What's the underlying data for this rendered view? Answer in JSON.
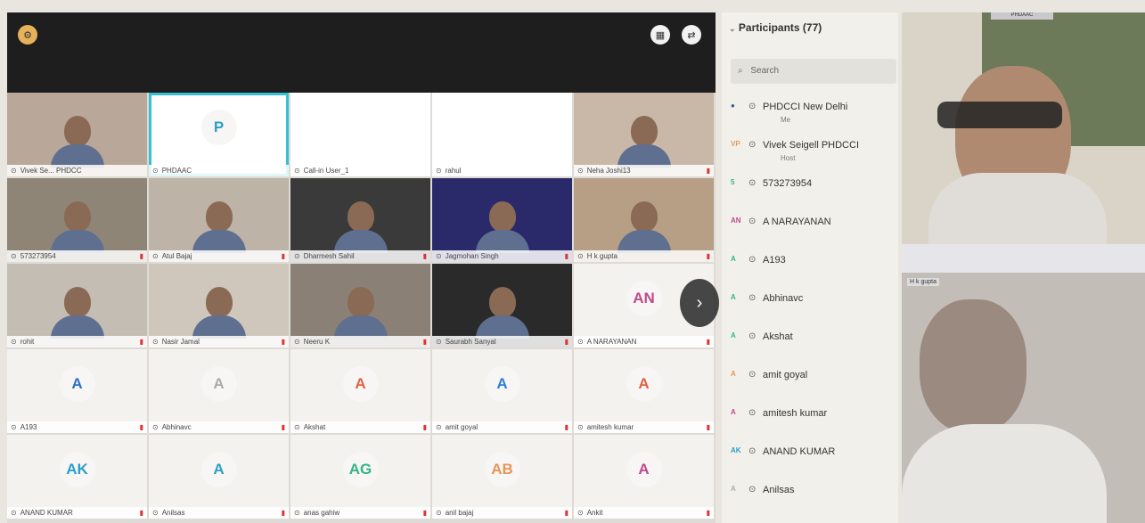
{
  "toolbar": {
    "settings_icon": "gear-icon",
    "grid_icon": "grid-icon",
    "share_icon": "share-icon"
  },
  "tiles": [
    {
      "label": "Vivek Se... PHDCC",
      "avatar": "",
      "video": true,
      "muted": false
    },
    {
      "label": "PHDAAC",
      "avatar": "P",
      "video": false,
      "muted": false,
      "highlight": true
    },
    {
      "label": "Call-in User_1",
      "avatar": "",
      "video": false,
      "muted": false
    },
    {
      "label": "rahul",
      "avatar": "",
      "video": false,
      "muted": false
    },
    {
      "label": "Neha Joshi13",
      "avatar": "",
      "video": true,
      "muted": true
    },
    {
      "label": "573273954",
      "avatar": "",
      "video": true,
      "muted": true
    },
    {
      "label": "Atul Bajaj",
      "avatar": "",
      "video": true,
      "muted": true
    },
    {
      "label": "Dharmesh Sahil",
      "avatar": "",
      "video": true,
      "muted": true
    },
    {
      "label": "Jagmohan Singh",
      "avatar": "",
      "video": true,
      "muted": true
    },
    {
      "label": "H k gupta",
      "avatar": "",
      "video": true,
      "muted": true
    },
    {
      "label": "rohit",
      "avatar": "",
      "video": true,
      "muted": true
    },
    {
      "label": "Nasir Jamal",
      "avatar": "",
      "video": true,
      "muted": true
    },
    {
      "label": "Neeru K",
      "avatar": "",
      "video": true,
      "muted": true
    },
    {
      "label": "Saurabh Sanyal",
      "avatar": "",
      "video": true,
      "muted": true
    },
    {
      "label": "A NARAYANAN",
      "avatar": "AN",
      "video": false,
      "muted": true
    },
    {
      "label": "A193",
      "avatar": "A",
      "video": false,
      "muted": true
    },
    {
      "label": "Abhinavc",
      "avatar": "A",
      "video": false,
      "muted": true
    },
    {
      "label": "Akshat",
      "avatar": "A",
      "video": false,
      "muted": true
    },
    {
      "label": "amit goyal",
      "avatar": "A",
      "video": false,
      "muted": true
    },
    {
      "label": "amitesh kumar",
      "avatar": "A",
      "video": false,
      "muted": true
    },
    {
      "label": "ANAND KUMAR",
      "avatar": "AK",
      "video": false,
      "muted": true
    },
    {
      "label": "Anilsas",
      "avatar": "A",
      "video": false,
      "muted": true
    },
    {
      "label": "anas gahiw",
      "avatar": "AG",
      "video": false,
      "muted": true
    },
    {
      "label": "anil bajaj",
      "avatar": "AB",
      "video": false,
      "muted": true
    },
    {
      "label": "Ankit",
      "avatar": "A",
      "video": false,
      "muted": true
    }
  ],
  "avatar_colors": [
    "#2a9fc9",
    "#2a9fc9",
    "#35b48a",
    "#e8955a",
    "#c04a8a",
    "#2a6fc9",
    "#aaaaaa",
    "#e06040",
    "#2a7fd9",
    "#e06040"
  ],
  "panel": {
    "title": "Participants (77)",
    "search_placeholder": "Search",
    "participants": [
      {
        "initials": "",
        "name": "PHDCCI New Delhi",
        "role": "Me",
        "color": "#335599"
      },
      {
        "initials": "VP",
        "name": "Vivek Seigell PHDCCI",
        "role": "Host",
        "color": "#e89a60"
      },
      {
        "initials": "5",
        "name": "573273954",
        "role": "",
        "color": "#35b48a"
      },
      {
        "initials": "AN",
        "name": "A NARAYANAN",
        "role": "",
        "color": "#c04a8a"
      },
      {
        "initials": "A",
        "name": "A193",
        "role": "",
        "color": "#35b48a"
      },
      {
        "initials": "A",
        "name": "Abhinavc",
        "role": "",
        "color": "#35b48a"
      },
      {
        "initials": "A",
        "name": "Akshat",
        "role": "",
        "color": "#35b48a"
      },
      {
        "initials": "A",
        "name": "amit goyal",
        "role": "",
        "color": "#e8955a"
      },
      {
        "initials": "A",
        "name": "amitesh kumar",
        "role": "",
        "color": "#c04a8a"
      },
      {
        "initials": "AK",
        "name": "ANAND KUMAR",
        "role": "",
        "color": "#2a9fc9"
      },
      {
        "initials": "A",
        "name": "Anilsas",
        "role": "",
        "color": "#aaaaaa"
      }
    ]
  },
  "right_video": {
    "top_label": "PHDAAC",
    "bottom_label": "H k gupta"
  }
}
